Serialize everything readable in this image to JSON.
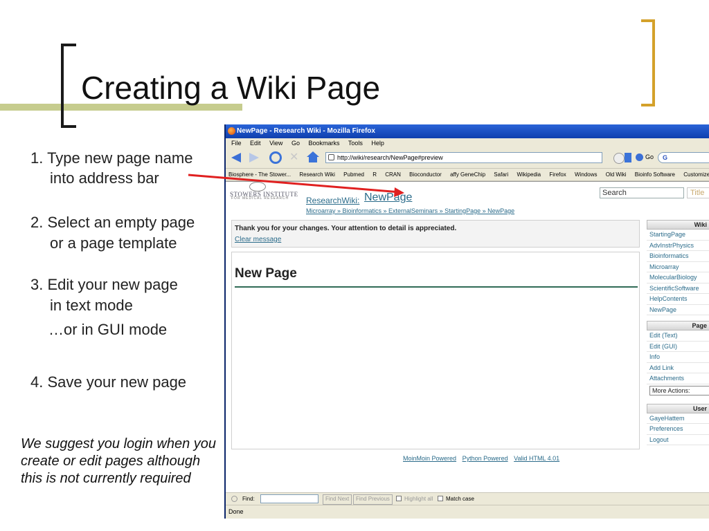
{
  "slide": {
    "title": "Creating a Wiki Page",
    "steps": [
      {
        "line1": "1. Type new page name",
        "line2": "into address bar"
      },
      {
        "line1": "2. Select an empty page",
        "line2": "or a page template"
      },
      {
        "line1": "3. Edit your new page",
        "line2": "in text mode",
        "line3": "…or in GUI mode"
      },
      {
        "line1": "4. Save your new page"
      }
    ],
    "note": "We suggest you login when you create or edit pages although this is not currently required",
    "colors": {
      "accent_olive": "#c6cc8e",
      "accent_gold": "#d4a12a",
      "arrow": "#e02020"
    }
  },
  "browser": {
    "window_title": "NewPage - Research Wiki - Mozilla Firefox",
    "menu": [
      "File",
      "Edit",
      "View",
      "Go",
      "Bookmarks",
      "Tools",
      "Help"
    ],
    "url": "http://wiki/research/NewPage#preview",
    "go_label": "Go",
    "search_engine_label": "G",
    "bookmarks": [
      "Biosphere - The Stower...",
      "Research Wiki",
      "Pubmed",
      "R",
      "CRAN",
      "Bioconductor",
      "affy GeneChip",
      "Safari",
      "Wikipedia",
      "Firefox",
      "Windows",
      "Old Wiki",
      "Bioinfo Software",
      "Customize Links"
    ],
    "find": {
      "label": "Find:",
      "next": "Find Next",
      "previous": "Find Previous",
      "highlight": "Highlight all",
      "match_case": "Match case"
    },
    "status": "Done"
  },
  "wiki": {
    "logo": "STOWERS INSTITUTE",
    "logo_sub": "FOR MEDICAL RESEARCH",
    "wiki_name": "ResearchWiki:",
    "page_name": "NewPage",
    "breadcrumbs": "Microarray » Bioinformatics » ExternalSeminars » StartingPage » NewPage",
    "search_placeholder": "Search",
    "title_button": "Title",
    "message": "Thank you for your changes. Your attention to detail is appreciated.",
    "clear_message": "Clear message",
    "page_heading": "New Page",
    "footer": [
      "MoinMoin Powered",
      "Python Powered",
      "Valid HTML 4.01"
    ],
    "sidebar": {
      "wiki_header": "Wiki",
      "wiki_items": [
        "StartingPage",
        "AdvInstrPhysics",
        "Bioinformatics",
        "Microarray",
        "MolecularBiology",
        "ScientificSoftware",
        "HelpContents",
        "NewPage"
      ],
      "page_header": "Page",
      "page_items": [
        "Edit (Text)",
        "Edit (GUI)",
        "Info",
        "Add Link",
        "Attachments"
      ],
      "more_actions": "More Actions:",
      "user_header": "User",
      "user_items": [
        "GayeHattem",
        "Preferences",
        "Logout"
      ]
    }
  }
}
